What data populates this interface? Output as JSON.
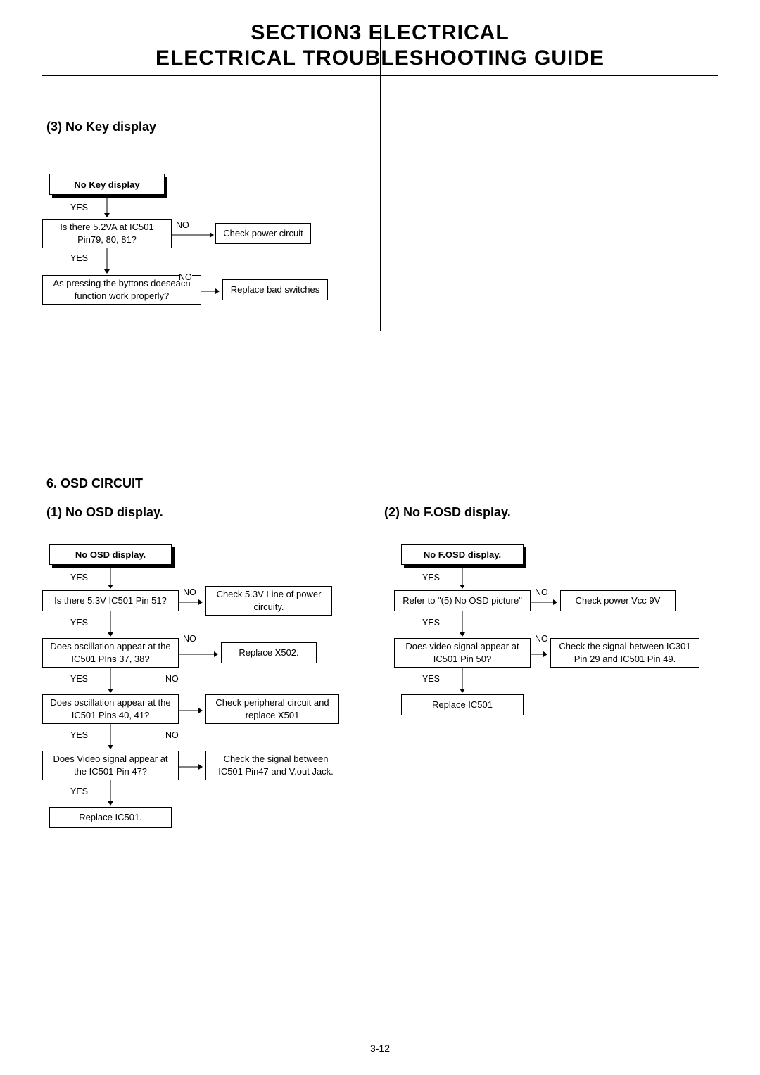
{
  "header": {
    "line1": "SECTION3   ELECTRICAL",
    "line2": "ELECTRICAL TROUBLESHOOTING GUIDE"
  },
  "section3": {
    "title": "(3) No Key display",
    "start": "No Key display",
    "yes": "YES",
    "no": "NO",
    "q1": "Is there 5.2VA at IC501 Pin79, 80, 81?",
    "a1": "Check power circuit",
    "q2": "As pressing the byttons doeseach function work properly?",
    "a2": "Replace bad switches"
  },
  "section6": {
    "title": "6. OSD CIRCUIT",
    "left": {
      "title": "(1) No OSD display.",
      "start": "No OSD display.",
      "yes": "YES",
      "no": "NO",
      "q1": "Is there 5.3V IC501 Pin 51?",
      "a1": "Check 5.3V Line of power circuity.",
      "q2": "Does oscillation appear at  the IC501 PIns 37, 38?",
      "a2": "Replace X502.",
      "q3": "Does oscillation appear at  the IC501 Pins 40, 41?",
      "a3": "Check peripheral circuit and replace X501",
      "q4": "Does Video signal appear at the IC501 Pin 47?",
      "a4": "Check the signal between IC501 Pin47 and V.out Jack.",
      "end": "Replace IC501."
    },
    "right": {
      "title": "(2) No F.OSD display.",
      "start": "No F.OSD display.",
      "yes": "YES",
      "no": "NO",
      "q1": "Refer to \"(5) No OSD picture\"",
      "a1": "Check power Vcc 9V",
      "q2": "Does video signal appear at IC501  Pin 50?",
      "a2": "Check the signal between IC301 Pin 29 and IC501 Pin 49.",
      "end": "Replace  IC501"
    }
  },
  "pagenum": "3-12"
}
